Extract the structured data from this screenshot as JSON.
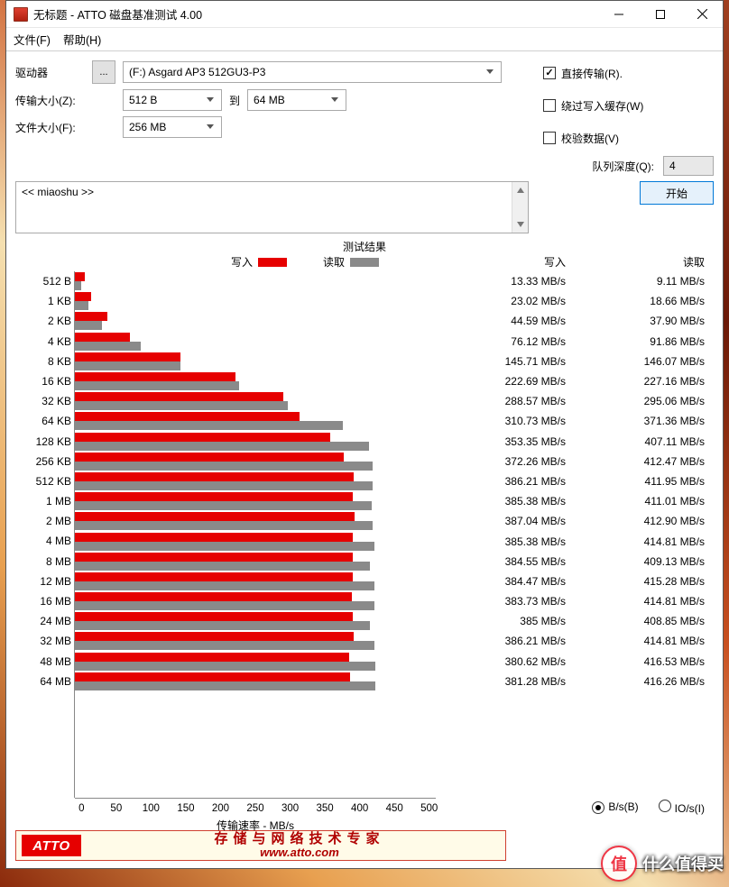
{
  "window": {
    "title": "无标题 - ATTO 磁盘基准测试 4.00"
  },
  "menubar": {
    "file": "文件(F)",
    "help": "帮助(H)"
  },
  "labels": {
    "drive": "驱动器",
    "transfer_size": "传输大小(Z):",
    "to": "到",
    "file_size": "文件大小(F):",
    "direct_io": "直接传输(R).",
    "bypass_write_cache": "绕过写入缓存(W)",
    "verify_data": "校验数据(V)",
    "queue_depth": "队列深度(Q):",
    "start": "开始",
    "dots": "...",
    "desc_placeholder": "<< miaoshu >>"
  },
  "selects": {
    "drive": "(F:) Asgard AP3 512GU3-P3",
    "min_size": "512 B",
    "max_size": "64 MB",
    "file_size": "256 MB",
    "queue_depth": "4"
  },
  "results": {
    "title": "测试结果",
    "legend_write": "写入",
    "legend_read": "读取",
    "col_write": "写入",
    "col_read": "读取",
    "axis_title": "传输速率 - MB/s",
    "radio_bs": "B/s(B)",
    "radio_ios": "IO/s(I)"
  },
  "footer": {
    "badge": "ATTO",
    "tagline": "存储与网络技术专家",
    "url": "www.atto.com"
  },
  "watermark": {
    "char": "值",
    "text": "什么值得买"
  },
  "chart_data": {
    "type": "bar",
    "title": "测试结果",
    "xlabel": "传输速率 - MB/s",
    "ylabel": "",
    "xlim": [
      0,
      500
    ],
    "ticks": [
      "0",
      "50",
      "100",
      "150",
      "200",
      "250",
      "300",
      "350",
      "400",
      "450",
      "500"
    ],
    "categories": [
      "512 B",
      "1 KB",
      "2 KB",
      "4 KB",
      "8 KB",
      "16 KB",
      "32 KB",
      "64 KB",
      "128 KB",
      "256 KB",
      "512 KB",
      "1 MB",
      "2 MB",
      "4 MB",
      "8 MB",
      "12 MB",
      "16 MB",
      "24 MB",
      "32 MB",
      "48 MB",
      "64 MB"
    ],
    "unit": "MB/s",
    "series": [
      {
        "name": "写入",
        "color": "#e60000",
        "values": [
          13.33,
          23.02,
          44.59,
          76.12,
          145.71,
          222.69,
          288.57,
          310.73,
          353.35,
          372.26,
          386.21,
          385.38,
          387.04,
          385.38,
          384.55,
          384.47,
          383.73,
          385,
          386.21,
          380.62,
          381.28
        ]
      },
      {
        "name": "读取",
        "color": "#8a8a8a",
        "values": [
          9.11,
          18.66,
          37.9,
          91.86,
          146.07,
          227.16,
          295.06,
          371.36,
          407.11,
          412.47,
          411.95,
          411.01,
          412.9,
          414.81,
          409.13,
          415.28,
          414.81,
          408.85,
          414.81,
          416.53,
          416.26
        ]
      }
    ],
    "write_disp": [
      "13.33",
      "23.02",
      "44.59",
      "76.12",
      "145.71",
      "222.69",
      "288.57",
      "310.73",
      "353.35",
      "372.26",
      "386.21",
      "385.38",
      "387.04",
      "385.38",
      "384.55",
      "384.47",
      "383.73",
      "385",
      "386.21",
      "380.62",
      "381.28"
    ],
    "read_disp": [
      "9.11",
      "18.66",
      "37.90",
      "91.86",
      "146.07",
      "227.16",
      "295.06",
      "371.36",
      "407.11",
      "412.47",
      "411.95",
      "411.01",
      "412.90",
      "414.81",
      "409.13",
      "415.28",
      "414.81",
      "408.85",
      "414.81",
      "416.53",
      "416.26"
    ]
  }
}
